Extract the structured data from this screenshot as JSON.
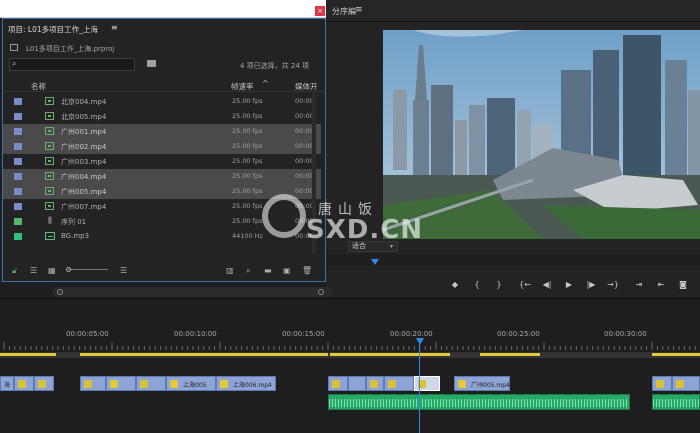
{
  "monitor": {
    "tab_label": "分序編",
    "menu_icon": "≡",
    "fit_label": "适合",
    "controls": [
      "◆",
      "{",
      "}",
      "{←",
      "◀|",
      "▶",
      "|▶",
      "→}",
      "⇥",
      "⇤",
      "◙"
    ]
  },
  "project": {
    "tab_label": "项目: L01多项目工作_上海",
    "tab_menu": "≡",
    "close_label": "×",
    "file_name": "L01多项目工作_上海.prproj",
    "search_value": "",
    "selected_info": "4 项已选择，共 24 项",
    "columns": {
      "name": "名称",
      "fps": "帧速率",
      "fps_sort": "^",
      "media": "媒体开"
    },
    "items": [
      {
        "name": "北京004.mp4",
        "fps": "25.00 fps",
        "media": "00:00:",
        "type": "video",
        "selected": false
      },
      {
        "name": "北京005.mp4",
        "fps": "25.00 fps",
        "media": "00:00:",
        "type": "video",
        "selected": false
      },
      {
        "name": "广州001.mp4",
        "fps": "25.00 fps",
        "media": "00:00:",
        "type": "video",
        "selected": true
      },
      {
        "name": "广州002.mp4",
        "fps": "25.00 fps",
        "media": "00:00:",
        "type": "video",
        "selected": true
      },
      {
        "name": "广州003.mp4",
        "fps": "25.00 fps",
        "media": "00:00:",
        "type": "video",
        "selected": false
      },
      {
        "name": "广州004.mp4",
        "fps": "25.00 fps",
        "media": "00:00:",
        "type": "video",
        "selected": true
      },
      {
        "name": "广州005.mp4",
        "fps": "25.00 fps",
        "media": "00:00:",
        "type": "video",
        "selected": true
      },
      {
        "name": "广州007.mp4",
        "fps": "25.00 fps",
        "media": "00:00:",
        "type": "video",
        "selected": false
      },
      {
        "name": "序列 01",
        "fps": "25.00 fps",
        "media": "00:00:",
        "type": "sequence",
        "selected": false
      },
      {
        "name": "BG.mp3",
        "fps": "44100 Hz",
        "media": "00:00:",
        "type": "audio",
        "selected": false
      }
    ],
    "colors": {
      "chip_video": "#7a8cc8",
      "chip_seq": "#55b86a",
      "chip_audio": "#2ec07c",
      "border": "#3a6fb0"
    }
  },
  "timeline": {
    "timecodes": [
      "00:00:05:00",
      "00:00:10:00",
      "00:00:15:00",
      "00:00:20:00",
      "00:00:25:00",
      "00:00:30:00"
    ],
    "video_clips": [
      "海",
      "",
      "",
      "",
      "",
      "",
      "上海005",
      "",
      "上海006.mp4",
      "",
      "",
      "",
      "",
      "",
      "广州005.mp4",
      "",
      ""
    ],
    "playhead_color": "#2d8ceb"
  },
  "watermark": {
    "title": "唐山饭",
    "url": "SXD.CN"
  }
}
